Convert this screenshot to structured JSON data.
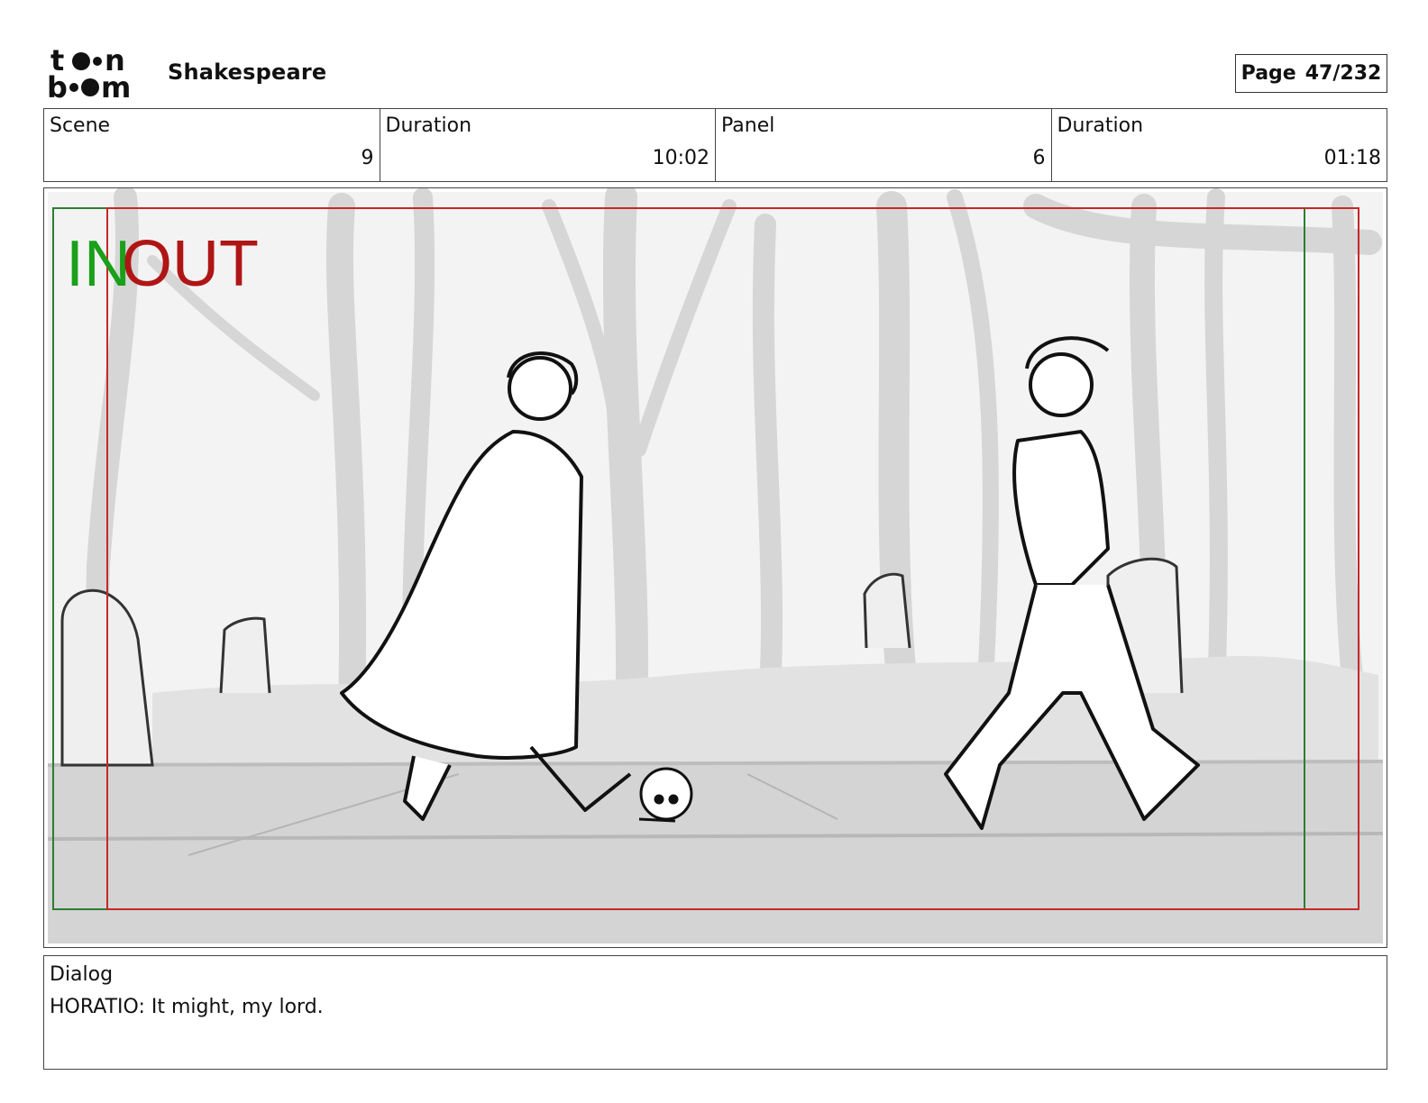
{
  "header": {
    "logo_text": "toon boom",
    "project_title": "Shakespeare",
    "page_label": "Page",
    "page_value": "47/232"
  },
  "info": {
    "scene_label": "Scene",
    "scene_value": "9",
    "scene_duration_label": "Duration",
    "scene_duration_value": "10:02",
    "panel_label": "Panel",
    "panel_value": "6",
    "panel_duration_label": "Duration",
    "panel_duration_value": "01:18"
  },
  "panel": {
    "in_marker": "IN",
    "out_marker": "OUT",
    "colors": {
      "in": "#1aa01a",
      "out": "#b01515",
      "safe_frame": "#2e7d32",
      "camera_frame": "#c62828"
    }
  },
  "dialog": {
    "label": "Dialog",
    "text": "HORATIO: It might, my lord."
  }
}
